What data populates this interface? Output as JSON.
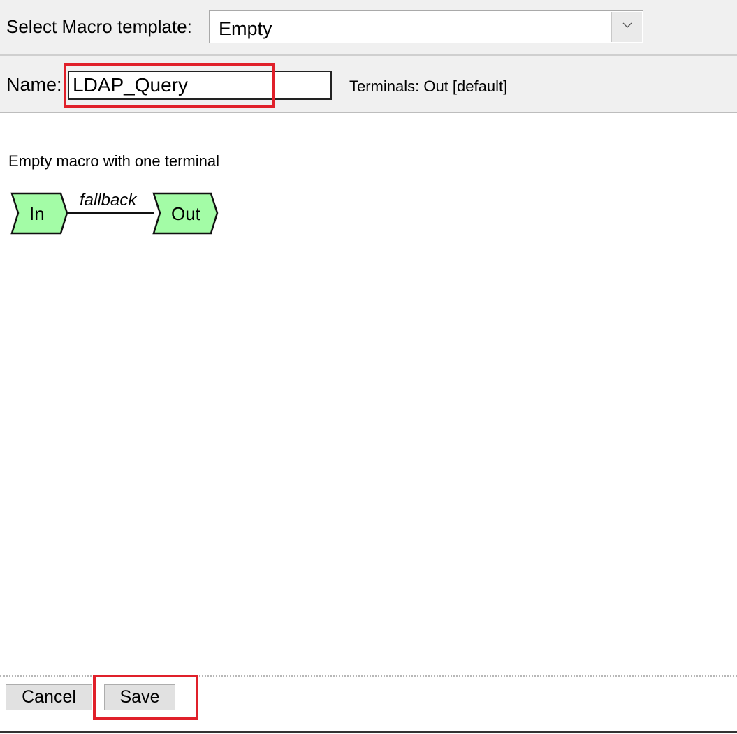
{
  "template": {
    "label": "Select Macro template:",
    "selected": "Empty"
  },
  "name_row": {
    "label": "Name:",
    "value": "LDAP_Query",
    "terminals": "Terminals: Out [default]"
  },
  "preview": {
    "description": "Empty macro with one terminal",
    "in_node": "In",
    "out_node": "Out",
    "edge_label": "fallback",
    "node_fill": "#a3fca6"
  },
  "footer": {
    "cancel_label": "Cancel",
    "save_label": "Save"
  },
  "highlight_color": "#e0202a"
}
